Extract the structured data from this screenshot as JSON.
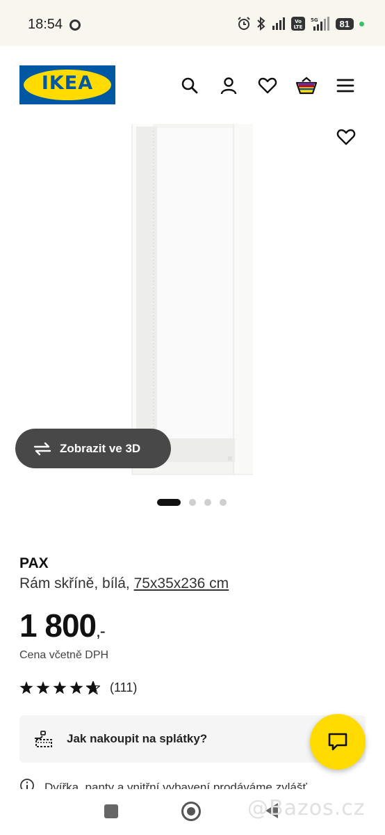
{
  "status_bar": {
    "time": "18:54",
    "network": "5G",
    "volte": "Vo LTE",
    "battery": "81"
  },
  "header": {
    "logo_text": "IKEA",
    "icons": [
      "search-icon",
      "account-icon",
      "heart-icon",
      "basket-icon",
      "menu-icon"
    ]
  },
  "gallery": {
    "view_3d_label": "Zobrazit ve 3D",
    "slides": 4,
    "active_slide": 1
  },
  "product": {
    "name": "PAX",
    "description": "Rám skříně, bílá, ",
    "dimensions": "75x35x236 cm",
    "price": "1 800",
    "price_suffix": ",-",
    "tax_note": "Cena včetně DPH",
    "rating_value": 4.5,
    "rating_max": 5,
    "rating_count": "(111)"
  },
  "installment": {
    "label": "Jak nakoupit na splátky?"
  },
  "notice": {
    "text": "Dvířka, panty a vnitřní vybavení prodáváme zvlášť"
  },
  "watermark": "@Bazos.cz",
  "colors": {
    "ikea_blue": "#0058a3",
    "ikea_yellow": "#ffdb00",
    "button_dark": "#484848"
  }
}
